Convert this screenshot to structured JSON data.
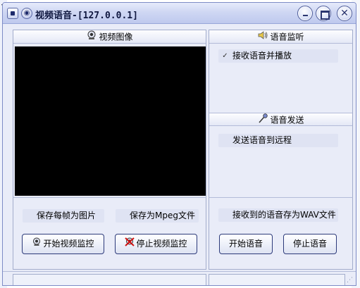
{
  "window": {
    "title": "视频语音-[127.0.0.1]"
  },
  "titlebar_buttons": {
    "minimize_icon": "minimize-icon",
    "maximize_icon": "maximize-icon",
    "close_glyph": "✕"
  },
  "video_panel": {
    "header": "视频图像",
    "header_icon": "webcam-icon",
    "checkboxes": {
      "save_frames": {
        "label": "保存每帧为图片",
        "checked": false
      },
      "save_mpeg": {
        "label": "保存为Mpeg文件",
        "checked": false
      }
    },
    "buttons": {
      "start": "开始视频监控",
      "stop": "停止视频监控"
    }
  },
  "listen_panel": {
    "header": "语音监听",
    "header_icon": "speaker-icon",
    "checkbox": {
      "label": "接收语音并播放",
      "checked": true,
      "mark": "✓"
    }
  },
  "send_panel": {
    "header": "语音发送",
    "header_icon": "microphone-icon",
    "checkbox": {
      "label": "发送语音到远程",
      "checked": false
    }
  },
  "voice_controls": {
    "checkbox": {
      "label": "接收到的语音存为WAV文件",
      "checked": false
    },
    "buttons": {
      "start": "开始语音",
      "stop": "停止语音"
    }
  },
  "background": {
    "edge_glyph": "<"
  },
  "colors": {
    "window_bg": "#e9ecf8",
    "titlebar": "#cfd7f3",
    "video_bg": "#000000",
    "button_border": "#2c3a7a"
  }
}
